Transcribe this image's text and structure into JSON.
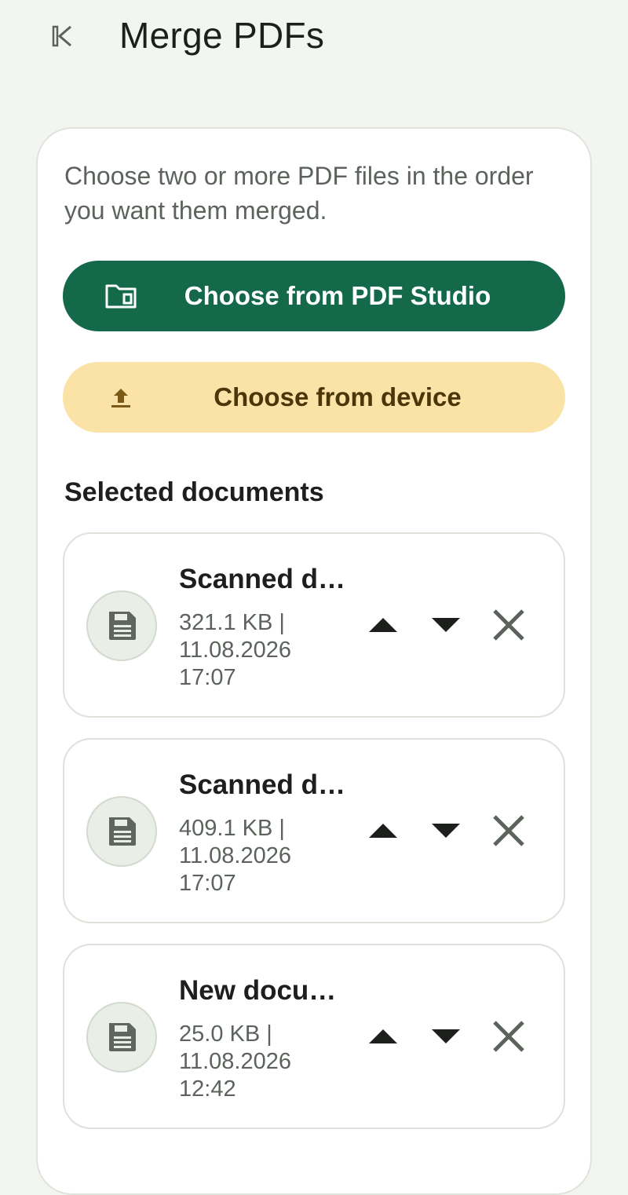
{
  "header": {
    "title": "Merge PDFs",
    "back_icon": "skip-back-icon"
  },
  "card": {
    "intro": "Choose two or more PDF files in the order you want them merged.",
    "primary_button": {
      "label": "Choose from PDF Studio",
      "icon": "folder-icon"
    },
    "secondary_button": {
      "label": "Choose from device",
      "icon": "upload-icon"
    },
    "section_title": "Selected documents"
  },
  "documents": [
    {
      "name": "Scanned d…",
      "size": "321.1 KB |",
      "date": "11.08.2026",
      "time": "17:07"
    },
    {
      "name": "Scanned d…",
      "size": "409.1 KB |",
      "date": "11.08.2026",
      "time": "17:07"
    },
    {
      "name": "New docu…",
      "size": "25.0 KB |",
      "date": "11.08.2026",
      "time": "12:42"
    }
  ],
  "colors": {
    "background": "#f3f5f1",
    "primary": "#14694a",
    "secondary": "#fbe3a7",
    "secondary_text": "#4a3608",
    "muted_text": "#5c635c"
  }
}
